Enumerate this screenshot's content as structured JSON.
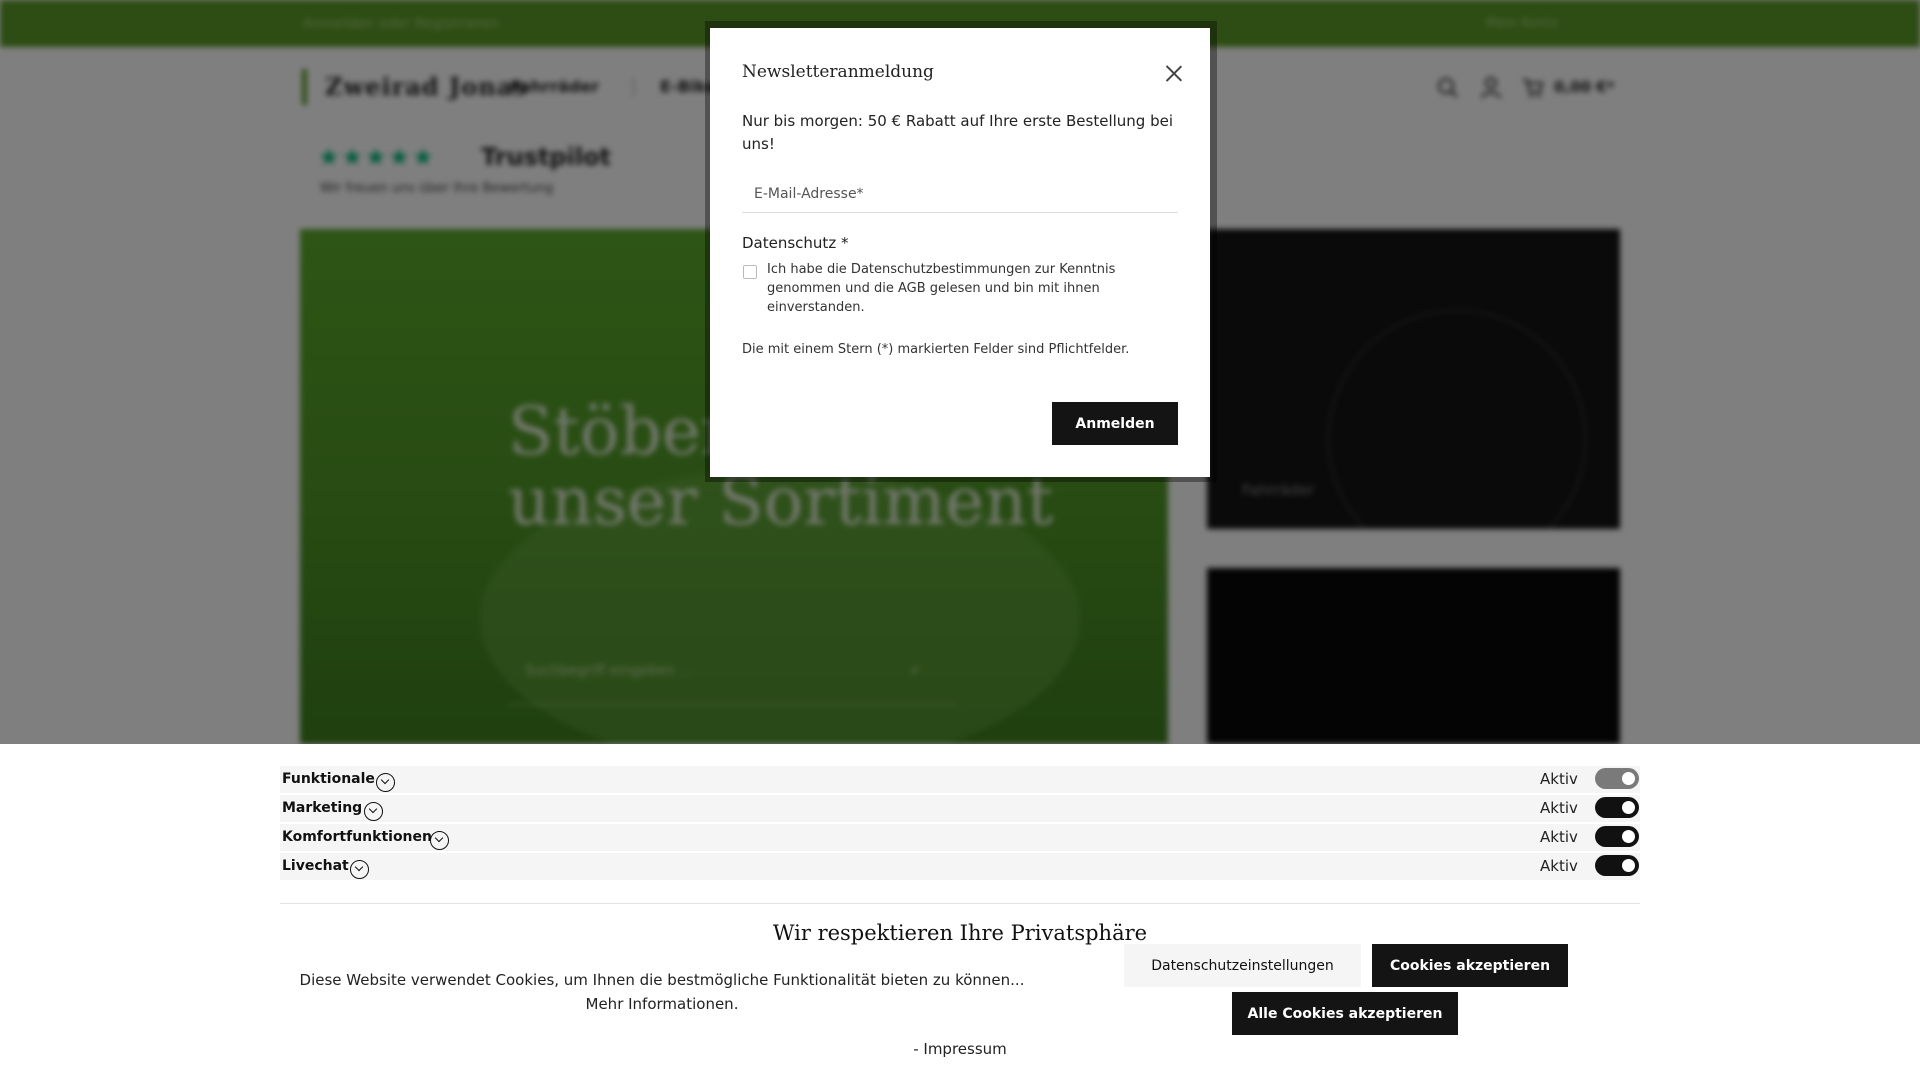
{
  "topbar": {
    "left_text": "Anmelden oder Registrieren",
    "right_text": "Mein Konto"
  },
  "header": {
    "logo_text": "Zweirad Jonas",
    "nav": [
      "Fahrräder",
      "E-Bikes"
    ],
    "cart_amount": "0,00 €*"
  },
  "trustpilot": {
    "stars": "★★★★★",
    "name": "Trustpilot",
    "subtitle": "Wir freuen uns über Ihre Bewertung"
  },
  "hero": {
    "title": "Stöbern durch unser Sortiment",
    "search_placeholder": "Suchbegriff eingeben ..."
  },
  "tiles": [
    {
      "label": "Fahrräder"
    }
  ],
  "newsletter_modal": {
    "title": "Newsletteranmeldung",
    "lead": "Nur bis morgen: 50 € Rabatt auf Ihre erste Bestellung bei uns!",
    "email_placeholder": "E-Mail-Adresse*",
    "privacy_label": "Datenschutz *",
    "privacy_text": "Ich habe die Datenschutzbestimmungen zur Kenntnis genommen und die AGB gelesen und bin mit ihnen einverstanden.",
    "required_note": "Die mit einem Stern (*) markierten Felder sind Pflichtfelder.",
    "submit_label": "Anmelden"
  },
  "cookie_banner": {
    "categories": [
      {
        "name": "Funktionale",
        "status": "Aktiv",
        "enabled": true,
        "locked": true
      },
      {
        "name": "Marketing",
        "status": "Aktiv",
        "enabled": true,
        "locked": false
      },
      {
        "name": "Komfortfunktionen",
        "status": "Aktiv",
        "enabled": true,
        "locked": false
      },
      {
        "name": "Livechat",
        "status": "Aktiv",
        "enabled": true,
        "locked": false
      }
    ],
    "title": "Wir respektieren Ihre Privatsphäre",
    "text": "Diese Website verwendet Cookies, um Ihnen die bestmögliche Funktionalität bieten zu können...",
    "more_info": "Mehr Informationen.",
    "settings_label": "Datenschutzeinstellungen",
    "accept_label": "Cookies akzeptieren",
    "accept_all_label": "Alle Cookies akzeptieren",
    "impressum": "- Impressum"
  },
  "colors": {
    "brand_green": "#5a9a28",
    "button_dark": "#141414",
    "trustpilot_green": "#00b67a"
  }
}
